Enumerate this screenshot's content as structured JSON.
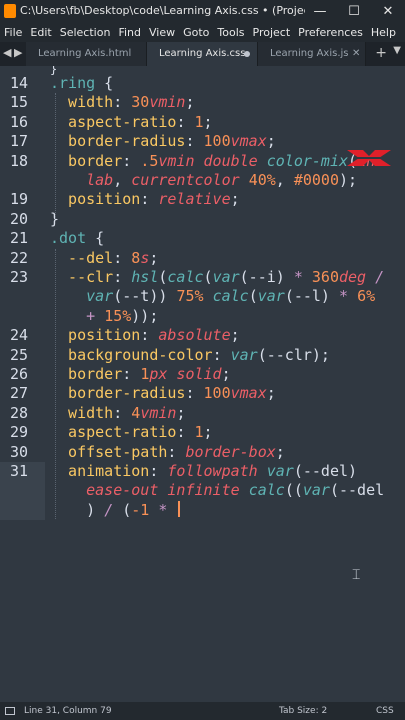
{
  "window": {
    "title": "C:\\Users\\fb\\Desktop\\code\\Learning Axis.css • (Project) - Sub..."
  },
  "menu": [
    "File",
    "Edit",
    "Selection",
    "Find",
    "View",
    "Goto",
    "Tools",
    "Project",
    "Preferences",
    "Help"
  ],
  "tabs": [
    {
      "label": "Learning Axis.html",
      "active": false
    },
    {
      "label": "Learning Axis.css",
      "active": true
    },
    {
      "label": "Learning Axis.js",
      "active": false
    }
  ],
  "editor": {
    "lines": [
      {
        "n": "14",
        "tokens": [
          [
            "sel",
            ".ring"
          ],
          [
            "punc",
            " {"
          ]
        ]
      },
      {
        "n": "15",
        "tokens": [
          [
            "prop",
            "  width"
          ],
          [
            "punc",
            ": "
          ],
          [
            "num",
            "30"
          ],
          [
            "val",
            "vmin"
          ],
          [
            "punc",
            ";"
          ]
        ]
      },
      {
        "n": "16",
        "tokens": [
          [
            "prop",
            "  aspect-ratio"
          ],
          [
            "punc",
            ": "
          ],
          [
            "num",
            "1"
          ],
          [
            "punc",
            ";"
          ]
        ]
      },
      {
        "n": "17",
        "tokens": [
          [
            "prop",
            "  border-radius"
          ],
          [
            "punc",
            ": "
          ],
          [
            "num",
            "100"
          ],
          [
            "val",
            "vmax"
          ],
          [
            "punc",
            ";"
          ]
        ]
      },
      {
        "n": "18",
        "tokens": [
          [
            "prop",
            "  border"
          ],
          [
            "punc",
            ": "
          ],
          [
            "num",
            ".5"
          ],
          [
            "val",
            "vmin double "
          ],
          [
            "fn",
            "color-mix"
          ],
          [
            "punc",
            "("
          ],
          [
            "val",
            "in"
          ]
        ]
      },
      {
        "n": "",
        "tokens": [
          [
            "val",
            "    lab"
          ],
          [
            "punc",
            ", "
          ],
          [
            "val",
            "currentcolor "
          ],
          [
            "num",
            "40%"
          ],
          [
            "punc",
            ", "
          ],
          [
            "num",
            "#0000"
          ],
          [
            "punc",
            ");"
          ]
        ]
      },
      {
        "n": "19",
        "tokens": [
          [
            "prop",
            "  position"
          ],
          [
            "punc",
            ": "
          ],
          [
            "val",
            "relative"
          ],
          [
            "punc",
            ";"
          ]
        ]
      },
      {
        "n": "20",
        "tokens": [
          [
            "punc",
            "}"
          ]
        ]
      },
      {
        "n": "21",
        "tokens": [
          [
            "sel",
            ".dot"
          ],
          [
            "punc",
            " {"
          ]
        ]
      },
      {
        "n": "22",
        "tokens": [
          [
            "prop",
            "  --del"
          ],
          [
            "punc",
            ": "
          ],
          [
            "num",
            "8"
          ],
          [
            "val",
            "s"
          ],
          [
            "punc",
            ";"
          ]
        ]
      },
      {
        "n": "23",
        "tokens": [
          [
            "prop",
            "  --clr"
          ],
          [
            "punc",
            ": "
          ],
          [
            "fn",
            "hsl"
          ],
          [
            "punc",
            "("
          ],
          [
            "fn",
            "calc"
          ],
          [
            "punc",
            "("
          ],
          [
            "fn",
            "var"
          ],
          [
            "punc",
            "(--i) "
          ],
          [
            "kw",
            "*"
          ],
          [
            "punc",
            " "
          ],
          [
            "num",
            "360"
          ],
          [
            "val",
            "deg"
          ],
          [
            "punc",
            " "
          ],
          [
            "kw",
            "/"
          ]
        ]
      },
      {
        "n": "",
        "tokens": [
          [
            "punc",
            "    "
          ],
          [
            "fn",
            "var"
          ],
          [
            "punc",
            "(--t)) "
          ],
          [
            "num",
            "75%"
          ],
          [
            "punc",
            " "
          ],
          [
            "fn",
            "calc"
          ],
          [
            "punc",
            "("
          ],
          [
            "fn",
            "var"
          ],
          [
            "punc",
            "(--l) "
          ],
          [
            "kw",
            "*"
          ],
          [
            "punc",
            " "
          ],
          [
            "num",
            "6%"
          ]
        ]
      },
      {
        "n": "",
        "tokens": [
          [
            "punc",
            "    "
          ],
          [
            "kw",
            "+"
          ],
          [
            "punc",
            " "
          ],
          [
            "num",
            "15%"
          ],
          [
            "punc",
            "));"
          ]
        ]
      },
      {
        "n": "24",
        "tokens": [
          [
            "prop",
            "  position"
          ],
          [
            "punc",
            ": "
          ],
          [
            "val",
            "absolute"
          ],
          [
            "punc",
            ";"
          ]
        ]
      },
      {
        "n": "25",
        "tokens": [
          [
            "prop",
            "  background-color"
          ],
          [
            "punc",
            ": "
          ],
          [
            "fn",
            "var"
          ],
          [
            "punc",
            "(--clr);"
          ]
        ]
      },
      {
        "n": "26",
        "tokens": [
          [
            "prop",
            "  border"
          ],
          [
            "punc",
            ": "
          ],
          [
            "num",
            "1"
          ],
          [
            "val",
            "px solid"
          ],
          [
            "punc",
            ";"
          ]
        ]
      },
      {
        "n": "27",
        "tokens": [
          [
            "prop",
            "  border-radius"
          ],
          [
            "punc",
            ": "
          ],
          [
            "num",
            "100"
          ],
          [
            "val",
            "vmax"
          ],
          [
            "punc",
            ";"
          ]
        ]
      },
      {
        "n": "28",
        "tokens": [
          [
            "prop",
            "  width"
          ],
          [
            "punc",
            ": "
          ],
          [
            "num",
            "4"
          ],
          [
            "val",
            "vmin"
          ],
          [
            "punc",
            ";"
          ]
        ]
      },
      {
        "n": "29",
        "tokens": [
          [
            "prop",
            "  aspect-ratio"
          ],
          [
            "punc",
            ": "
          ],
          [
            "num",
            "1"
          ],
          [
            "punc",
            ";"
          ]
        ]
      },
      {
        "n": "30",
        "tokens": [
          [
            "prop",
            "  offset-path"
          ],
          [
            "punc",
            ": "
          ],
          [
            "val",
            "border-box"
          ],
          [
            "punc",
            ";"
          ]
        ]
      },
      {
        "n": "31",
        "tokens": [
          [
            "prop",
            "  animation"
          ],
          [
            "punc",
            ": "
          ],
          [
            "val",
            "followpath "
          ],
          [
            "fn",
            "var"
          ],
          [
            "punc",
            "(--del)"
          ]
        ]
      },
      {
        "n": "",
        "tokens": [
          [
            "val",
            "    ease-out infinite "
          ],
          [
            "fn",
            "calc"
          ],
          [
            "punc",
            "(("
          ],
          [
            "fn",
            "var"
          ],
          [
            "punc",
            "(--del"
          ]
        ]
      },
      {
        "n": "",
        "tokens": [
          [
            "punc",
            "    ) "
          ],
          [
            "kw",
            "/"
          ],
          [
            "punc",
            " ("
          ],
          [
            "num",
            "-1"
          ],
          [
            "punc",
            " "
          ],
          [
            "kw",
            "*"
          ],
          [
            "punc",
            " "
          ]
        ]
      }
    ]
  },
  "status": {
    "position": "Line 31, Column 79",
    "tab_size": "Tab Size: 2",
    "syntax": "CSS"
  },
  "colors": {
    "background": "#303841",
    "chrome": "#23292f",
    "logo": "#e0202a"
  }
}
